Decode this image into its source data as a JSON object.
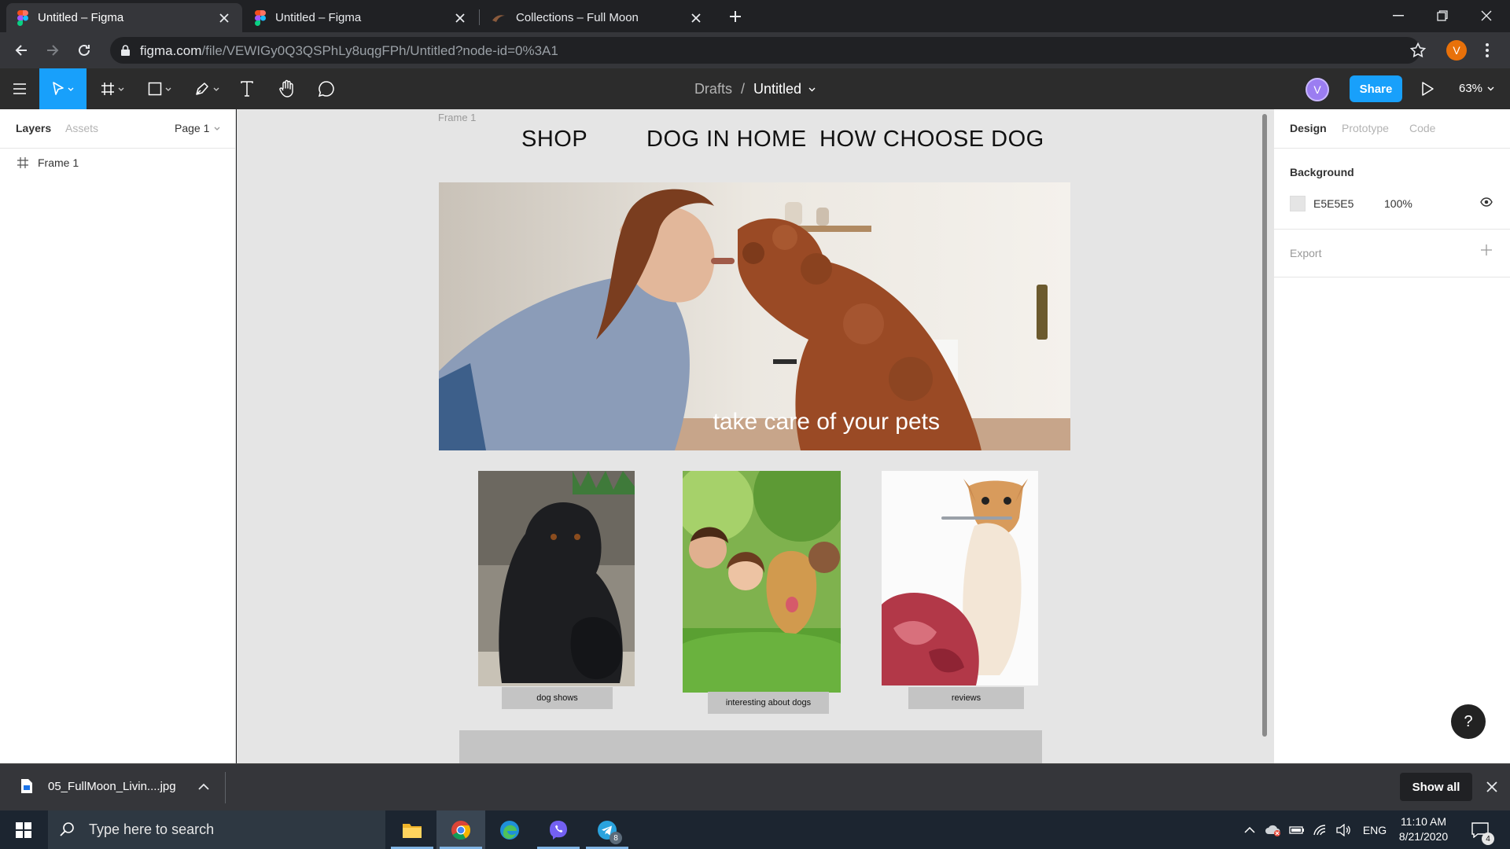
{
  "browser": {
    "tabs": [
      {
        "title": "Untitled – Figma",
        "active": true
      },
      {
        "title": "Untitled – Figma",
        "active": false
      },
      {
        "title": "Collections – Full Moon",
        "active": false
      }
    ],
    "url_host": "figma.com",
    "url_path": "/file/VEWIGy0Q3QSPhLy8uqgFPh/Untitled?node-id=0%3A1",
    "profile_initial": "V"
  },
  "figma": {
    "breadcrumb_parent": "Drafts",
    "breadcrumb_sep": "/",
    "file_name": "Untitled",
    "user_initial": "V",
    "share_label": "Share",
    "zoom": "63%",
    "left_panel": {
      "tabs": [
        "Layers",
        "Assets"
      ],
      "page": "Page 1",
      "layers": [
        {
          "name": "Frame 1"
        }
      ]
    },
    "right_panel": {
      "tabs": [
        "Design",
        "Prototype",
        "Code"
      ],
      "background_title": "Background",
      "background_hex": "E5E5E5",
      "background_opacity": "100%",
      "export_title": "Export",
      "help": "?"
    }
  },
  "design": {
    "frame_label": "Frame 1",
    "nav": [
      "SHOP",
      "DOG IN HOME",
      "HOW CHOOSE DOG"
    ],
    "hero_caption": "take care of your pets",
    "cards": [
      {
        "label": "dog shows"
      },
      {
        "label": "interesting about dogs"
      },
      {
        "label": "reviews"
      }
    ]
  },
  "download_bar": {
    "file": "05_FullMoon_Livin....jpg",
    "show_all": "Show all"
  },
  "taskbar": {
    "search_placeholder": "Type here to search",
    "telegram_badge": "8",
    "language": "ENG",
    "time": "11:10 AM",
    "date": "8/21/2020",
    "notification_count": "4"
  },
  "colors": {
    "figma_blue": "#18a0fb",
    "canvas_bg": "#e5e5e5",
    "toolbar": "#2c2c2c",
    "chrome_dark": "#202124",
    "profile_orange": "#e8710a"
  }
}
